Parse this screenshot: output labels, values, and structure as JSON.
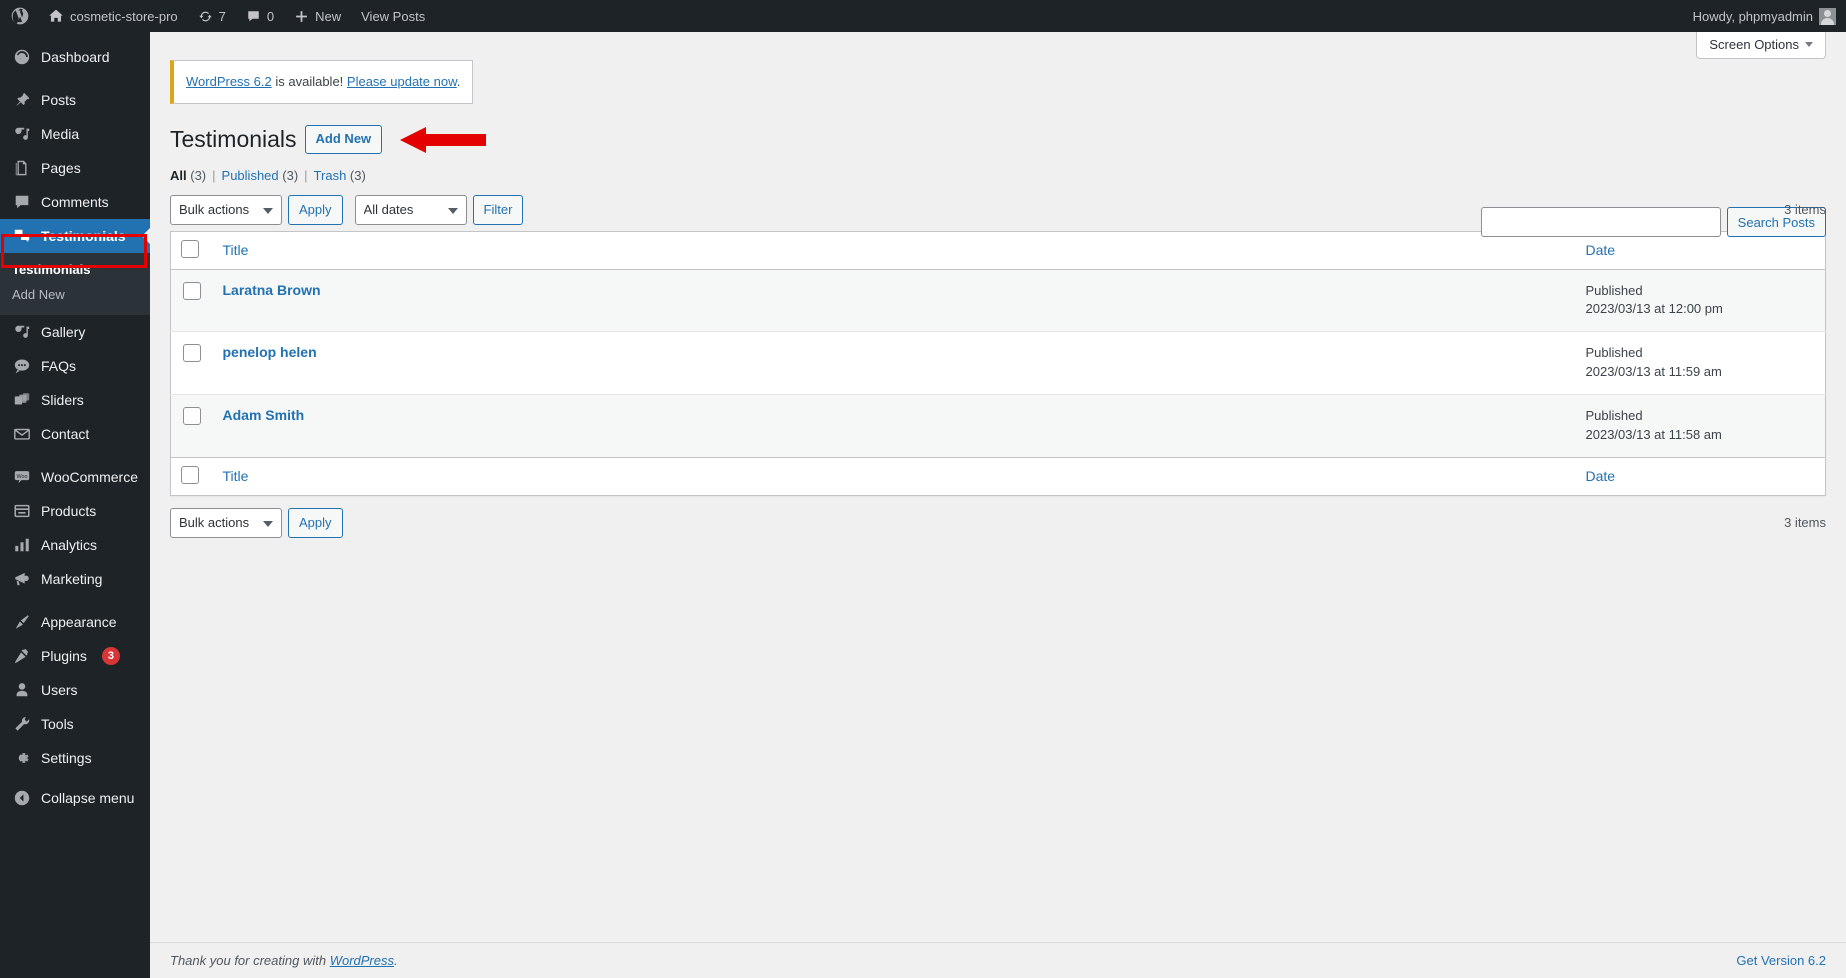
{
  "adminbar": {
    "site_name": "cosmetic-store-pro",
    "updates_count": "7",
    "comments_count": "0",
    "new_label": "New",
    "view_posts_label": "View Posts",
    "howdy": "Howdy, phpmyadmin"
  },
  "sidebar": {
    "items": [
      {
        "label": "Dashboard",
        "icon": "dashboard-icon",
        "current": false
      },
      {
        "label": "Posts",
        "icon": "pin-icon",
        "current": false
      },
      {
        "label": "Media",
        "icon": "media-icon",
        "current": false
      },
      {
        "label": "Pages",
        "icon": "pages-icon",
        "current": false
      },
      {
        "label": "Comments",
        "icon": "comments-icon",
        "current": false
      },
      {
        "label": "Testimonials",
        "icon": "testimonials-icon",
        "current": true
      },
      {
        "label": "Gallery",
        "icon": "gallery-icon",
        "current": false
      },
      {
        "label": "FAQs",
        "icon": "faqs-icon",
        "current": false
      },
      {
        "label": "Sliders",
        "icon": "sliders-icon",
        "current": false
      },
      {
        "label": "Contact",
        "icon": "mail-icon",
        "current": false
      },
      {
        "label": "WooCommerce",
        "icon": "woocommerce-icon",
        "current": false
      },
      {
        "label": "Products",
        "icon": "products-icon",
        "current": false
      },
      {
        "label": "Analytics",
        "icon": "analytics-icon",
        "current": false
      },
      {
        "label": "Marketing",
        "icon": "marketing-icon",
        "current": false
      },
      {
        "label": "Appearance",
        "icon": "appearance-icon",
        "current": false
      },
      {
        "label": "Plugins",
        "icon": "plugins-icon",
        "current": false,
        "badge": "3"
      },
      {
        "label": "Users",
        "icon": "users-icon",
        "current": false
      },
      {
        "label": "Tools",
        "icon": "tools-icon",
        "current": false
      },
      {
        "label": "Settings",
        "icon": "settings-icon",
        "current": false
      }
    ],
    "submenu": [
      {
        "label": "Testimonials",
        "current": true
      },
      {
        "label": "Add New",
        "current": false
      }
    ],
    "collapse_label": "Collapse menu",
    "highlight_color": "#e50000"
  },
  "screen_meta": {
    "screen_options_label": "Screen Options"
  },
  "notice": {
    "link_version": "WordPress 6.2",
    "text_middle": " is available! ",
    "link_update": "Please update now",
    "text_end": ".",
    "accent_color": "#dba617"
  },
  "page": {
    "title": "Testimonials",
    "add_new_label": "Add New"
  },
  "filters": {
    "all_label": "All",
    "all_count": "(3)",
    "published_label": "Published",
    "published_count": "(3)",
    "trash_label": "Trash",
    "trash_count": "(3)",
    "separator": "|"
  },
  "tablenav_top": {
    "bulk_actions_label": "Bulk actions",
    "apply_label": "Apply",
    "all_dates_label": "All dates",
    "filter_label": "Filter",
    "items_count": "3 items"
  },
  "tablenav_bottom": {
    "bulk_actions_label": "Bulk actions",
    "apply_label": "Apply",
    "items_count": "3 items"
  },
  "search": {
    "value": "",
    "placeholder": "",
    "button_label": "Search Posts"
  },
  "table": {
    "columns": [
      "Title",
      "Date"
    ],
    "rows": [
      {
        "title": "Laratna Brown",
        "status": "Published",
        "date": "2023/03/13 at 12:00 pm"
      },
      {
        "title": "penelop helen",
        "status": "Published",
        "date": "2023/03/13 at 11:59 am"
      },
      {
        "title": "Adam Smith",
        "status": "Published",
        "date": "2023/03/13 at 11:58 am"
      }
    ]
  },
  "footer": {
    "thanks_prefix": "Thank you for creating with ",
    "wordpress_link": "WordPress",
    "thanks_suffix": ".",
    "version_label": "Get Version 6.2"
  }
}
